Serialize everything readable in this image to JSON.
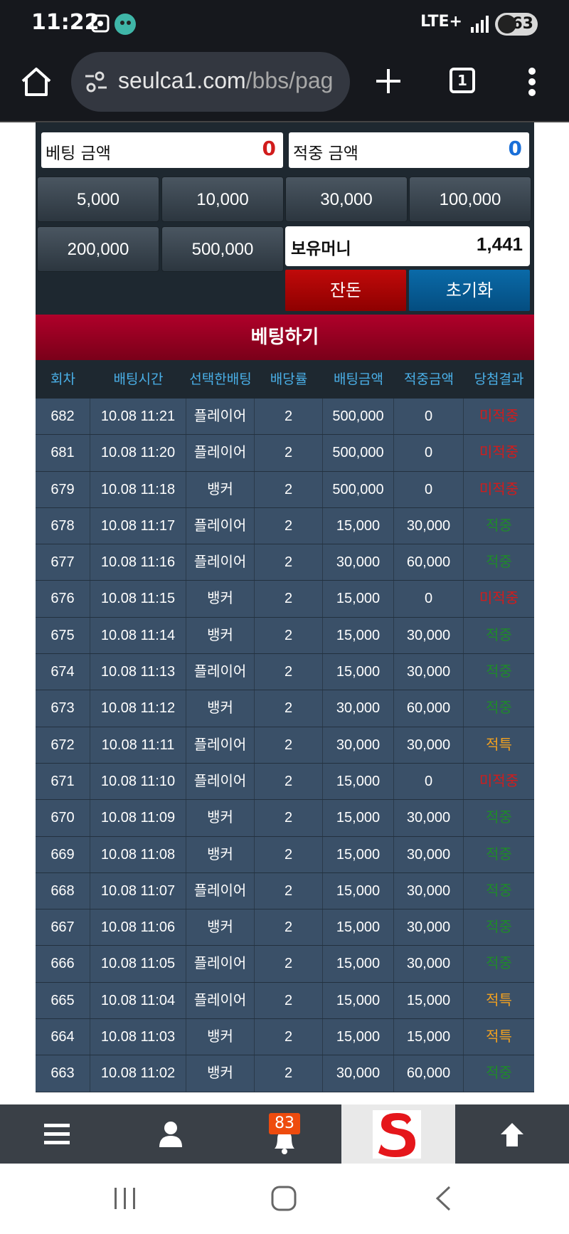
{
  "status": {
    "time": "11:22",
    "network": "LTE+",
    "battery": "63"
  },
  "browser": {
    "url_host": "seulca1.com",
    "url_path": "/bbs/pag",
    "tab_count": "1"
  },
  "bet_panel": {
    "bet_amount_label": "베팅 금액",
    "bet_amount_value": "0",
    "hit_amount_label": "적중 금액",
    "hit_amount_value": "0",
    "chips": [
      "5,000",
      "10,000",
      "30,000",
      "100,000",
      "200,000",
      "500,000"
    ],
    "money_label": "보유머니",
    "money_value": "1,441",
    "balance_button": "잔돈",
    "reset_button": "초기화",
    "bet_button": "베팅하기"
  },
  "table": {
    "headers": [
      "회차",
      "배팅시간",
      "선택한배팅",
      "배당률",
      "배팅금액",
      "적중금액",
      "당첨결과"
    ],
    "rows": [
      {
        "round": "682",
        "time": "10.08 11:21",
        "pick": "플레이어",
        "odds": "2",
        "bet": "500,000",
        "win": "0",
        "result": "미적중",
        "type": "lose"
      },
      {
        "round": "681",
        "time": "10.08 11:20",
        "pick": "플레이어",
        "odds": "2",
        "bet": "500,000",
        "win": "0",
        "result": "미적중",
        "type": "lose"
      },
      {
        "round": "679",
        "time": "10.08 11:18",
        "pick": "뱅커",
        "odds": "2",
        "bet": "500,000",
        "win": "0",
        "result": "미적중",
        "type": "lose"
      },
      {
        "round": "678",
        "time": "10.08 11:17",
        "pick": "플레이어",
        "odds": "2",
        "bet": "15,000",
        "win": "30,000",
        "result": "적중",
        "type": "win"
      },
      {
        "round": "677",
        "time": "10.08 11:16",
        "pick": "플레이어",
        "odds": "2",
        "bet": "30,000",
        "win": "60,000",
        "result": "적중",
        "type": "win"
      },
      {
        "round": "676",
        "time": "10.08 11:15",
        "pick": "뱅커",
        "odds": "2",
        "bet": "15,000",
        "win": "0",
        "result": "미적중",
        "type": "lose"
      },
      {
        "round": "675",
        "time": "10.08 11:14",
        "pick": "뱅커",
        "odds": "2",
        "bet": "15,000",
        "win": "30,000",
        "result": "적중",
        "type": "win"
      },
      {
        "round": "674",
        "time": "10.08 11:13",
        "pick": "플레이어",
        "odds": "2",
        "bet": "15,000",
        "win": "30,000",
        "result": "적중",
        "type": "win"
      },
      {
        "round": "673",
        "time": "10.08 11:12",
        "pick": "뱅커",
        "odds": "2",
        "bet": "30,000",
        "win": "60,000",
        "result": "적중",
        "type": "win"
      },
      {
        "round": "672",
        "time": "10.08 11:11",
        "pick": "플레이어",
        "odds": "2",
        "bet": "30,000",
        "win": "30,000",
        "result": "적특",
        "type": "hit"
      },
      {
        "round": "671",
        "time": "10.08 11:10",
        "pick": "플레이어",
        "odds": "2",
        "bet": "15,000",
        "win": "0",
        "result": "미적중",
        "type": "lose"
      },
      {
        "round": "670",
        "time": "10.08 11:09",
        "pick": "뱅커",
        "odds": "2",
        "bet": "15,000",
        "win": "30,000",
        "result": "적중",
        "type": "win"
      },
      {
        "round": "669",
        "time": "10.08 11:08",
        "pick": "뱅커",
        "odds": "2",
        "bet": "15,000",
        "win": "30,000",
        "result": "적중",
        "type": "win"
      },
      {
        "round": "668",
        "time": "10.08 11:07",
        "pick": "플레이어",
        "odds": "2",
        "bet": "15,000",
        "win": "30,000",
        "result": "적중",
        "type": "win"
      },
      {
        "round": "667",
        "time": "10.08 11:06",
        "pick": "뱅커",
        "odds": "2",
        "bet": "15,000",
        "win": "30,000",
        "result": "적중",
        "type": "win"
      },
      {
        "round": "666",
        "time": "10.08 11:05",
        "pick": "플레이어",
        "odds": "2",
        "bet": "15,000",
        "win": "30,000",
        "result": "적중",
        "type": "win"
      },
      {
        "round": "665",
        "time": "10.08 11:04",
        "pick": "플레이어",
        "odds": "2",
        "bet": "15,000",
        "win": "15,000",
        "result": "적특",
        "type": "hit"
      },
      {
        "round": "664",
        "time": "10.08 11:03",
        "pick": "뱅커",
        "odds": "2",
        "bet": "15,000",
        "win": "15,000",
        "result": "적특",
        "type": "hit"
      },
      {
        "round": "663",
        "time": "10.08 11:02",
        "pick": "뱅커",
        "odds": "2",
        "bet": "30,000",
        "win": "60,000",
        "result": "적중",
        "type": "win"
      }
    ]
  },
  "bottom_nav": {
    "notification_count": "83",
    "icons": [
      "menu-icon",
      "user-icon",
      "bell-icon",
      "site-logo",
      "arrow-up-icon"
    ]
  },
  "colors": {
    "lose": "#d11c1c",
    "win": "#1f8a2a",
    "hit": "#f0a020",
    "header_text": "#4ab0e8",
    "bet_bar": "#a00024"
  }
}
